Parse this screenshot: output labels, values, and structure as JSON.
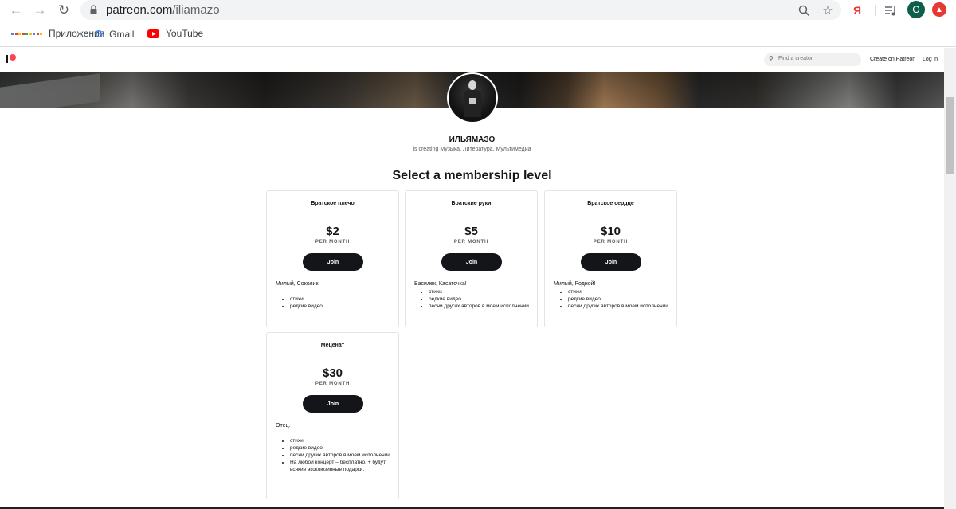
{
  "browser": {
    "url_host": "patreon.com",
    "url_path": "/iliamazo",
    "bookmarks": [
      {
        "label": "Приложения",
        "icon": "apps-grid-icon"
      },
      {
        "label": "Gmail",
        "icon": "google-icon"
      },
      {
        "label": "YouTube",
        "icon": "youtube-icon"
      }
    ],
    "profile_initial": "O",
    "yandex_glyph": "Я"
  },
  "header": {
    "search_placeholder": "Find a creator",
    "create_label": "Create on Patreon",
    "login_label": "Log in"
  },
  "creator": {
    "name": "ИЛЬЯМАЗО",
    "subtitle": "is creating Музыка, Литература, Мультимедиа"
  },
  "section_title": "Select a membership level",
  "tiers": [
    {
      "name": "Братское плечо",
      "price": "$2",
      "per": "PER MONTH",
      "join": "Join",
      "description": "Милый, Соколик!",
      "benefits": [
        "стихи",
        "редкие видео"
      ]
    },
    {
      "name": "Братские руки",
      "price": "$5",
      "per": "PER MONTH",
      "join": "Join",
      "description": "Василек, Касаточка!",
      "benefits": [
        "стихи",
        "редкие видео",
        "песни других авторов в моем исполнении"
      ]
    },
    {
      "name": "Братское сердце",
      "price": "$10",
      "per": "PER MONTH",
      "join": "Join",
      "description": "Милый, Родной!",
      "benefits": [
        "стихи",
        "редкие видео",
        "песни других авторов в моем исполнении"
      ]
    },
    {
      "name": "Меценат",
      "price": "$30",
      "per": "PER MONTH",
      "join": "Join",
      "description": "Отец.",
      "benefits": [
        "стихи",
        "редкие видео",
        "песни других авторов в моем исполнении",
        "На любой концерт – бесплатно. + будут всякие эксклюзивные подарки."
      ]
    }
  ],
  "colors": {
    "patreon_coral": "#ff424d",
    "button_black": "#141518",
    "profile_avatar": "#0d5e4a"
  }
}
